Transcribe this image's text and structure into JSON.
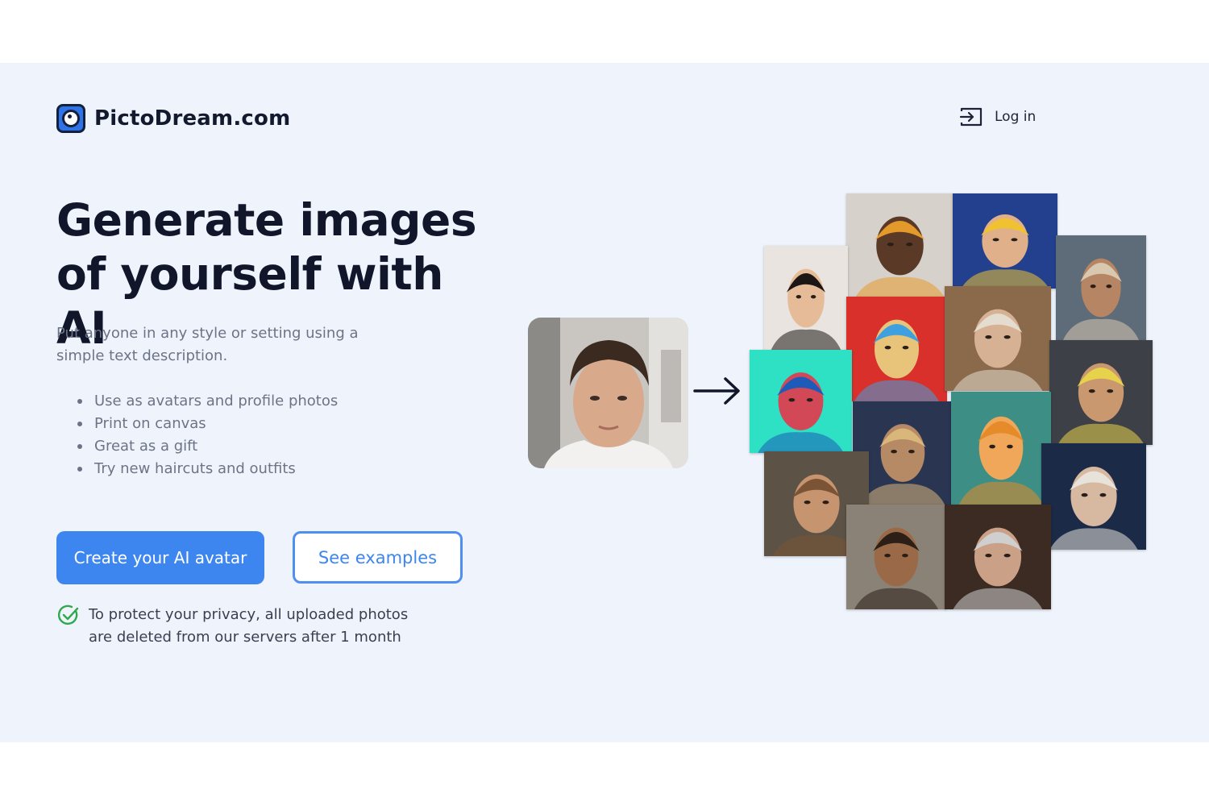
{
  "brand": {
    "name": "PictoDream.com"
  },
  "nav": {
    "login_label": "Log in"
  },
  "hero": {
    "headline": "Generate images of yourself with AI",
    "subtitle": "Put anyone in any style or setting using a simple text description.",
    "benefits": [
      "Use as avatars and profile photos",
      "Print on canvas",
      "Great as a gift",
      "Try new haircuts and outfits"
    ],
    "primary_cta": "Create your AI avatar",
    "secondary_cta": "See examples",
    "privacy_note": "To protect your privacy, all uploaded photos are deleted from our servers after 1 month"
  },
  "colors": {
    "hero_background": "#eff4fc",
    "accent": "#3e86ef",
    "headline": "#11162b",
    "muted_text": "#6d7386",
    "check_green": "#2fa84f"
  },
  "icons": {
    "logo": "camera-lens-logo-icon",
    "login": "login-icon",
    "arrow": "arrow-right-icon",
    "privacy": "check-circle-icon"
  }
}
